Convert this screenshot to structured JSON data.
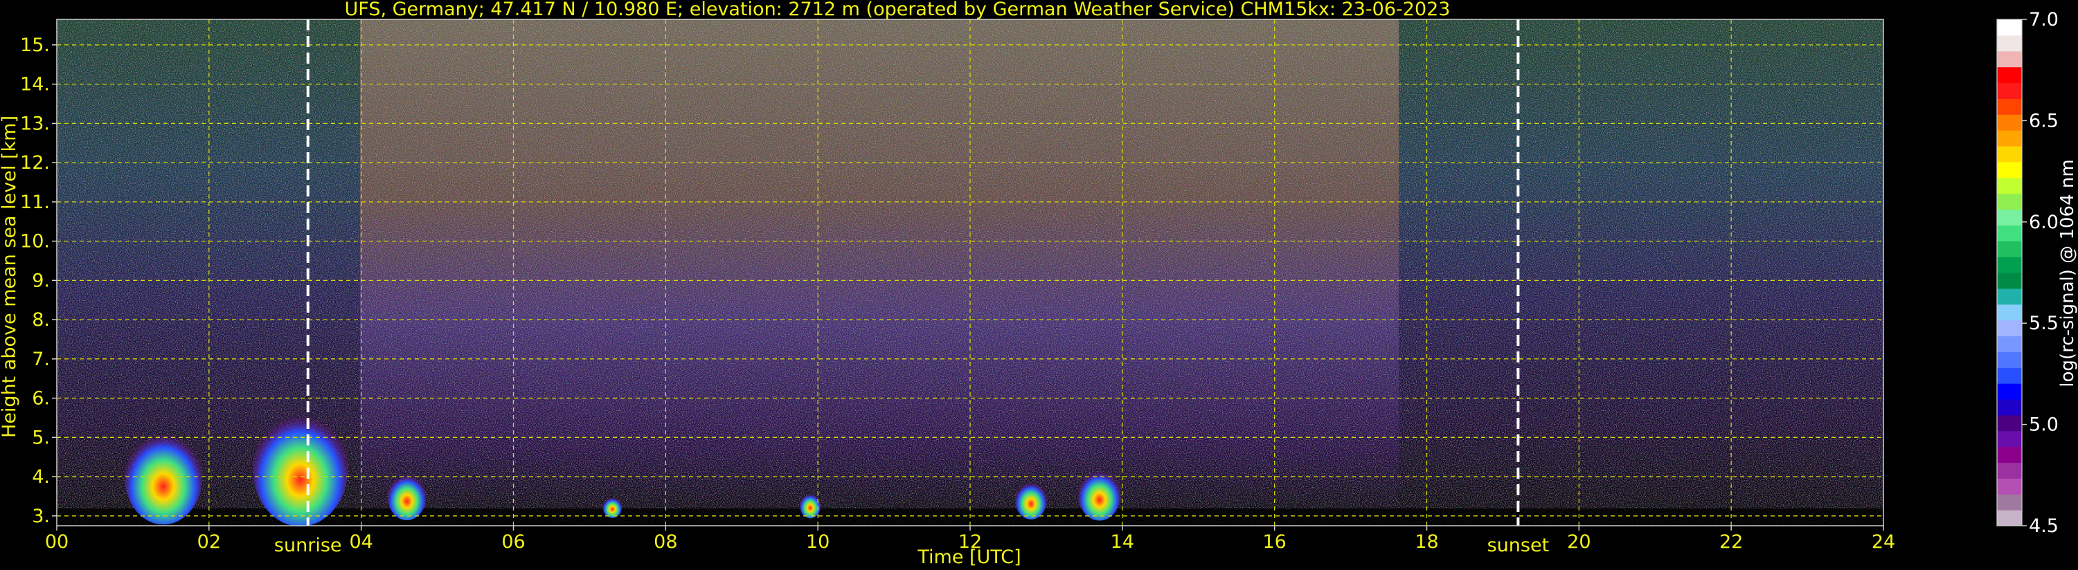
{
  "chart_data": {
    "type": "heatmap",
    "title": "UFS, Germany; 47.417 N / 10.980 E; elevation: 2712 m  (operated by German Weather Service)    CHM15kx: 23-06-2023",
    "xlabel": "Time [UTC]",
    "ylabel": "Height above mean sea level [km]",
    "xlim": [
      0,
      24
    ],
    "ylim": [
      2.75,
      15.65
    ],
    "x_ticks": [
      "00",
      "02",
      "04",
      "06",
      "08",
      "10",
      "12",
      "14",
      "16",
      "18",
      "20",
      "22",
      "24"
    ],
    "y_ticks": [
      "3.",
      "4.",
      "5.",
      "6.",
      "7.",
      "8.",
      "9.",
      "10.",
      "11.",
      "12.",
      "13.",
      "14.",
      "15."
    ],
    "grid": true,
    "colorbar": {
      "label": "log(rc-signal) @ 1064 nm",
      "range": [
        4.5,
        7.0
      ],
      "ticks": [
        "4.5",
        "5.0",
        "5.5",
        "6.0",
        "6.5",
        "7.0"
      ],
      "colors": [
        "#c8b4c8",
        "#a078a0",
        "#b450b4",
        "#9b30a0",
        "#8b008b",
        "#6a0dad",
        "#4b0082",
        "#1e00c8",
        "#0000ff",
        "#2850ff",
        "#5078ff",
        "#7896ff",
        "#a0b4ff",
        "#87cefa",
        "#20b2aa",
        "#008b45",
        "#00a050",
        "#20c060",
        "#40e080",
        "#78f0a0",
        "#90ee50",
        "#c0ff30",
        "#ffff00",
        "#ffd700",
        "#ffa500",
        "#ff7f00",
        "#ff4500",
        "#ff1a1a",
        "#ff0000",
        "#f0b4b4",
        "#f0e6e6",
        "#ffffff"
      ]
    },
    "annotations": [
      {
        "text": "sunrise",
        "x": 3.3
      },
      {
        "text": "sunset",
        "x": 19.2
      }
    ],
    "cloud_events": [
      {
        "time": 1.4,
        "top": 5.2
      },
      {
        "time": 3.2,
        "top": 5.7
      },
      {
        "time": 4.6,
        "top": 4.1
      },
      {
        "time": 7.3,
        "top": 3.5
      },
      {
        "time": 9.9,
        "top": 3.6
      },
      {
        "time": 12.8,
        "top": 3.9
      },
      {
        "time": 13.7,
        "top": 4.2
      }
    ]
  }
}
